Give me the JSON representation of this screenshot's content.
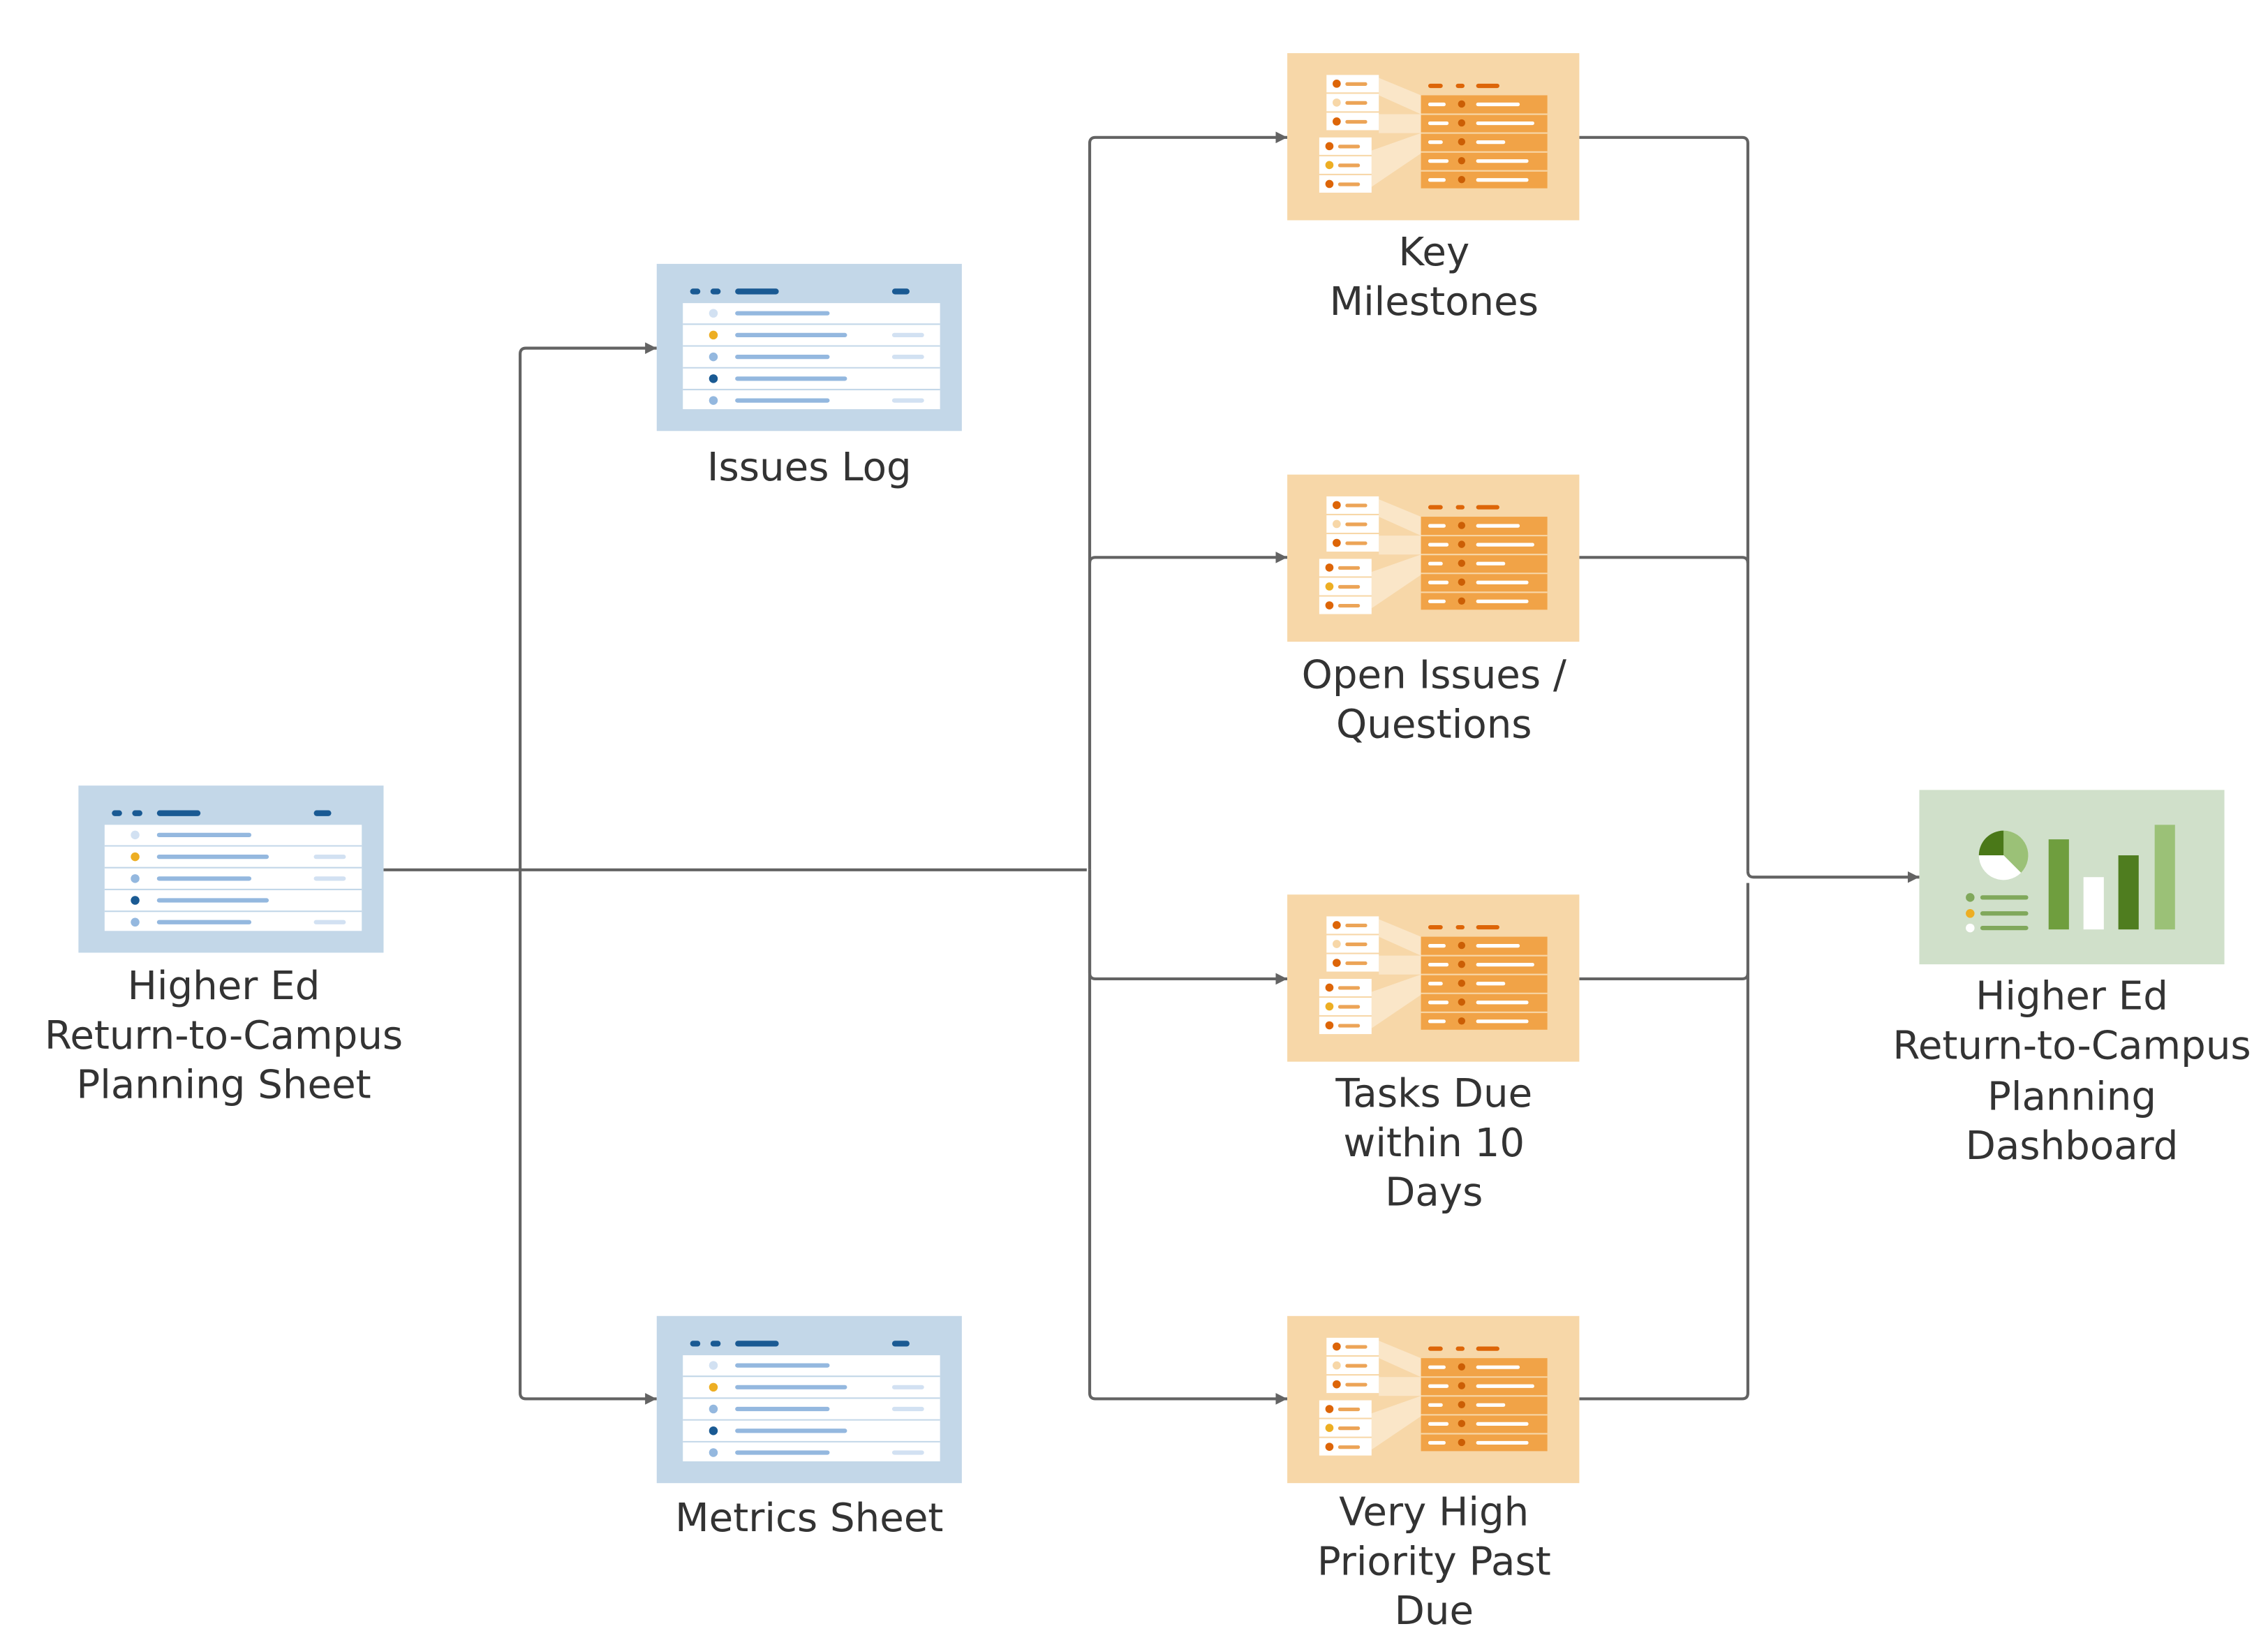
{
  "diagram": {
    "type": "data-flow",
    "colors": {
      "sheet_bg": "#c3d7e8",
      "sheet_dark": "#1a5a93",
      "sheet_mid": "#94b8df",
      "sheet_light": "#d2e1f2",
      "accent_yellow": "#edae23",
      "report_bg": "#f7d7a8",
      "report_table": "#f1a347",
      "report_dark": "#dd6508",
      "report_dot": "#cb5e05",
      "dashboard_bg": "#d0e0ca",
      "dash_dark": "#4a7818",
      "dash_mid": "#6f9e3e",
      "dash_light": "#9bc177",
      "connector": "#636363",
      "text": "#333333"
    },
    "nodes": [
      {
        "id": "source",
        "kind": "sheet",
        "label_lines": [
          "Higher Ed",
          "Return-to-Campus",
          "Planning Sheet"
        ]
      },
      {
        "id": "issues-log",
        "kind": "sheet",
        "label_lines": [
          "Issues Log"
        ]
      },
      {
        "id": "metrics-sheet",
        "kind": "sheet",
        "label_lines": [
          "Metrics Sheet"
        ]
      },
      {
        "id": "key-milestones",
        "kind": "report",
        "label_lines": [
          "Key",
          "Milestones"
        ]
      },
      {
        "id": "open-issues",
        "kind": "report",
        "label_lines": [
          "Open Issues /",
          "Questions"
        ]
      },
      {
        "id": "tasks-due",
        "kind": "report",
        "label_lines": [
          "Tasks Due",
          "within 10",
          "Days"
        ]
      },
      {
        "id": "very-high-priority",
        "kind": "report",
        "label_lines": [
          "Very High",
          "Priority Past",
          "Due"
        ]
      },
      {
        "id": "dashboard",
        "kind": "dashboard",
        "label_lines": [
          "Higher Ed",
          "Return-to-Campus",
          "Planning",
          "Dashboard"
        ]
      }
    ],
    "edges": [
      {
        "from": "source",
        "to": "issues-log"
      },
      {
        "from": "source",
        "to": "metrics-sheet"
      },
      {
        "from": "source",
        "to": "key-milestones"
      },
      {
        "from": "source",
        "to": "open-issues"
      },
      {
        "from": "source",
        "to": "tasks-due"
      },
      {
        "from": "source",
        "to": "very-high-priority"
      },
      {
        "from": "key-milestones",
        "to": "dashboard"
      },
      {
        "from": "open-issues",
        "to": "dashboard"
      },
      {
        "from": "tasks-due",
        "to": "dashboard"
      },
      {
        "from": "very-high-priority",
        "to": "dashboard"
      }
    ]
  }
}
